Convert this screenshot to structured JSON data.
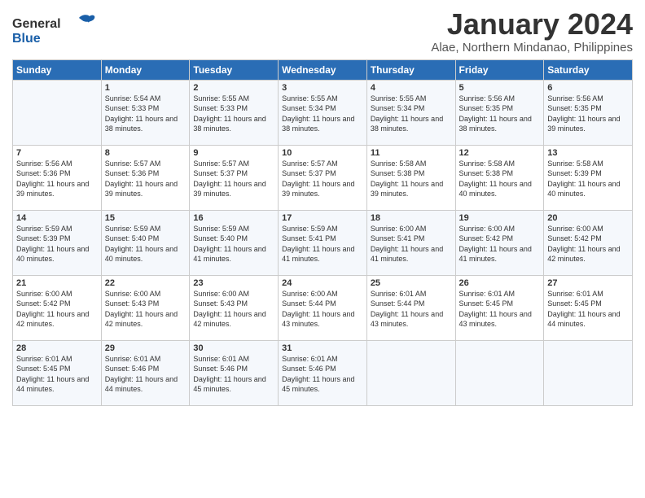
{
  "logo": {
    "line1": "General",
    "line2": "Blue"
  },
  "title": "January 2024",
  "subtitle": "Alae, Northern Mindanao, Philippines",
  "headers": [
    "Sunday",
    "Monday",
    "Tuesday",
    "Wednesday",
    "Thursday",
    "Friday",
    "Saturday"
  ],
  "weeks": [
    [
      {
        "day": "",
        "sunrise": "",
        "sunset": "",
        "daylight": ""
      },
      {
        "day": "1",
        "sunrise": "Sunrise: 5:54 AM",
        "sunset": "Sunset: 5:33 PM",
        "daylight": "Daylight: 11 hours and 38 minutes."
      },
      {
        "day": "2",
        "sunrise": "Sunrise: 5:55 AM",
        "sunset": "Sunset: 5:33 PM",
        "daylight": "Daylight: 11 hours and 38 minutes."
      },
      {
        "day": "3",
        "sunrise": "Sunrise: 5:55 AM",
        "sunset": "Sunset: 5:34 PM",
        "daylight": "Daylight: 11 hours and 38 minutes."
      },
      {
        "day": "4",
        "sunrise": "Sunrise: 5:55 AM",
        "sunset": "Sunset: 5:34 PM",
        "daylight": "Daylight: 11 hours and 38 minutes."
      },
      {
        "day": "5",
        "sunrise": "Sunrise: 5:56 AM",
        "sunset": "Sunset: 5:35 PM",
        "daylight": "Daylight: 11 hours and 38 minutes."
      },
      {
        "day": "6",
        "sunrise": "Sunrise: 5:56 AM",
        "sunset": "Sunset: 5:35 PM",
        "daylight": "Daylight: 11 hours and 39 minutes."
      }
    ],
    [
      {
        "day": "7",
        "sunrise": "Sunrise: 5:56 AM",
        "sunset": "Sunset: 5:36 PM",
        "daylight": "Daylight: 11 hours and 39 minutes."
      },
      {
        "day": "8",
        "sunrise": "Sunrise: 5:57 AM",
        "sunset": "Sunset: 5:36 PM",
        "daylight": "Daylight: 11 hours and 39 minutes."
      },
      {
        "day": "9",
        "sunrise": "Sunrise: 5:57 AM",
        "sunset": "Sunset: 5:37 PM",
        "daylight": "Daylight: 11 hours and 39 minutes."
      },
      {
        "day": "10",
        "sunrise": "Sunrise: 5:57 AM",
        "sunset": "Sunset: 5:37 PM",
        "daylight": "Daylight: 11 hours and 39 minutes."
      },
      {
        "day": "11",
        "sunrise": "Sunrise: 5:58 AM",
        "sunset": "Sunset: 5:38 PM",
        "daylight": "Daylight: 11 hours and 39 minutes."
      },
      {
        "day": "12",
        "sunrise": "Sunrise: 5:58 AM",
        "sunset": "Sunset: 5:38 PM",
        "daylight": "Daylight: 11 hours and 40 minutes."
      },
      {
        "day": "13",
        "sunrise": "Sunrise: 5:58 AM",
        "sunset": "Sunset: 5:39 PM",
        "daylight": "Daylight: 11 hours and 40 minutes."
      }
    ],
    [
      {
        "day": "14",
        "sunrise": "Sunrise: 5:59 AM",
        "sunset": "Sunset: 5:39 PM",
        "daylight": "Daylight: 11 hours and 40 minutes."
      },
      {
        "day": "15",
        "sunrise": "Sunrise: 5:59 AM",
        "sunset": "Sunset: 5:40 PM",
        "daylight": "Daylight: 11 hours and 40 minutes."
      },
      {
        "day": "16",
        "sunrise": "Sunrise: 5:59 AM",
        "sunset": "Sunset: 5:40 PM",
        "daylight": "Daylight: 11 hours and 41 minutes."
      },
      {
        "day": "17",
        "sunrise": "Sunrise: 5:59 AM",
        "sunset": "Sunset: 5:41 PM",
        "daylight": "Daylight: 11 hours and 41 minutes."
      },
      {
        "day": "18",
        "sunrise": "Sunrise: 6:00 AM",
        "sunset": "Sunset: 5:41 PM",
        "daylight": "Daylight: 11 hours and 41 minutes."
      },
      {
        "day": "19",
        "sunrise": "Sunrise: 6:00 AM",
        "sunset": "Sunset: 5:42 PM",
        "daylight": "Daylight: 11 hours and 41 minutes."
      },
      {
        "day": "20",
        "sunrise": "Sunrise: 6:00 AM",
        "sunset": "Sunset: 5:42 PM",
        "daylight": "Daylight: 11 hours and 42 minutes."
      }
    ],
    [
      {
        "day": "21",
        "sunrise": "Sunrise: 6:00 AM",
        "sunset": "Sunset: 5:42 PM",
        "daylight": "Daylight: 11 hours and 42 minutes."
      },
      {
        "day": "22",
        "sunrise": "Sunrise: 6:00 AM",
        "sunset": "Sunset: 5:43 PM",
        "daylight": "Daylight: 11 hours and 42 minutes."
      },
      {
        "day": "23",
        "sunrise": "Sunrise: 6:00 AM",
        "sunset": "Sunset: 5:43 PM",
        "daylight": "Daylight: 11 hours and 42 minutes."
      },
      {
        "day": "24",
        "sunrise": "Sunrise: 6:00 AM",
        "sunset": "Sunset: 5:44 PM",
        "daylight": "Daylight: 11 hours and 43 minutes."
      },
      {
        "day": "25",
        "sunrise": "Sunrise: 6:01 AM",
        "sunset": "Sunset: 5:44 PM",
        "daylight": "Daylight: 11 hours and 43 minutes."
      },
      {
        "day": "26",
        "sunrise": "Sunrise: 6:01 AM",
        "sunset": "Sunset: 5:45 PM",
        "daylight": "Daylight: 11 hours and 43 minutes."
      },
      {
        "day": "27",
        "sunrise": "Sunrise: 6:01 AM",
        "sunset": "Sunset: 5:45 PM",
        "daylight": "Daylight: 11 hours and 44 minutes."
      }
    ],
    [
      {
        "day": "28",
        "sunrise": "Sunrise: 6:01 AM",
        "sunset": "Sunset: 5:45 PM",
        "daylight": "Daylight: 11 hours and 44 minutes."
      },
      {
        "day": "29",
        "sunrise": "Sunrise: 6:01 AM",
        "sunset": "Sunset: 5:46 PM",
        "daylight": "Daylight: 11 hours and 44 minutes."
      },
      {
        "day": "30",
        "sunrise": "Sunrise: 6:01 AM",
        "sunset": "Sunset: 5:46 PM",
        "daylight": "Daylight: 11 hours and 45 minutes."
      },
      {
        "day": "31",
        "sunrise": "Sunrise: 6:01 AM",
        "sunset": "Sunset: 5:46 PM",
        "daylight": "Daylight: 11 hours and 45 minutes."
      },
      {
        "day": "",
        "sunrise": "",
        "sunset": "",
        "daylight": ""
      },
      {
        "day": "",
        "sunrise": "",
        "sunset": "",
        "daylight": ""
      },
      {
        "day": "",
        "sunrise": "",
        "sunset": "",
        "daylight": ""
      }
    ]
  ]
}
